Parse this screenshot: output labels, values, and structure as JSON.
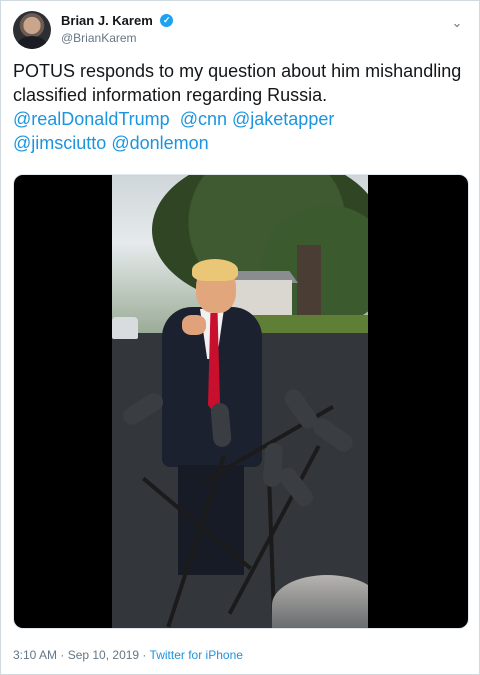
{
  "tweet": {
    "author": {
      "display_name": "Brian J. Karem",
      "handle": "@BrianKarem",
      "verified": true
    },
    "text_parts": [
      {
        "type": "text",
        "value": "POTUS responds to my question about him mishandling classified information regarding Russia. "
      },
      {
        "type": "mention",
        "value": "@realDonaldTrump"
      },
      {
        "type": "text",
        "value": "  "
      },
      {
        "type": "mention",
        "value": "@cnn"
      },
      {
        "type": "text",
        "value": " "
      },
      {
        "type": "mention",
        "value": "@jaketapper"
      },
      {
        "type": "text",
        "value": " "
      },
      {
        "type": "mention",
        "value": "@jimsciutto"
      },
      {
        "type": "text",
        "value": " "
      },
      {
        "type": "mention",
        "value": "@donlemon"
      }
    ],
    "timestamp": "3:10 AM · Sep 10, 2019 · ",
    "source": "Twitter for iPhone"
  },
  "icons": {
    "verified": "verified-badge-icon",
    "menu": "chevron-down-icon"
  },
  "colors": {
    "link": "#1b95e0",
    "verified": "#1da1f2",
    "text": "#14171a",
    "secondary": "#657786"
  }
}
